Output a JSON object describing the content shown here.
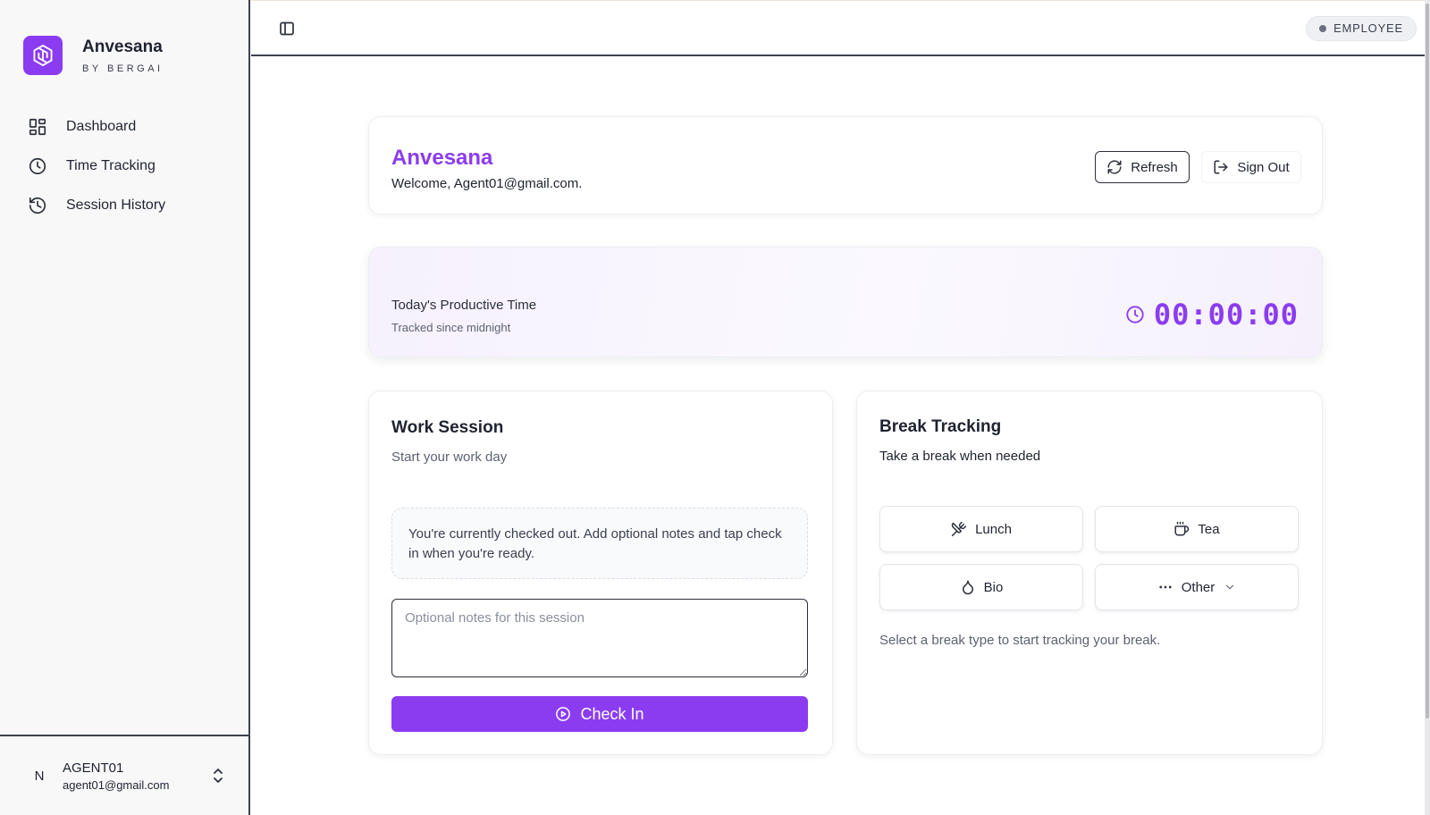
{
  "brand": {
    "name": "Anvesana",
    "subtitle": "BY BERGAI",
    "accent": "#8B3CF0"
  },
  "sidebar": {
    "items": [
      {
        "label": "Dashboard",
        "icon": "dashboard-icon"
      },
      {
        "label": "Time Tracking",
        "icon": "clock-icon"
      },
      {
        "label": "Session History",
        "icon": "history-icon"
      }
    ],
    "user": {
      "initial": "N",
      "name": "AGENT01",
      "email": "agent01@gmail.com"
    }
  },
  "header": {
    "role_badge": "EMPLOYEE",
    "toggle_icon": "sidebar-toggle-icon"
  },
  "welcome": {
    "title": "Anvesana",
    "text": "Welcome, Agent01@gmail.com.",
    "refresh_label": "Refresh",
    "signout_label": "Sign Out"
  },
  "productive": {
    "title": "Today's Productive Time",
    "subtitle": "Tracked since midnight",
    "timer": "00:00:00"
  },
  "work_session": {
    "title": "Work Session",
    "subtitle": "Start your work day",
    "notice": "You're currently checked out. Add optional notes and tap check in when you're ready.",
    "notes_placeholder": "Optional notes for this session",
    "notes_value": "",
    "checkin_label": "Check In"
  },
  "break_tracking": {
    "title": "Break Tracking",
    "subtitle": "Take a break when needed",
    "buttons": [
      {
        "label": "Lunch",
        "icon": "utensils-crossed-icon"
      },
      {
        "label": "Tea",
        "icon": "coffee-cup-icon"
      },
      {
        "label": "Bio",
        "icon": "droplet-icon"
      },
      {
        "label": "Other",
        "icon": "more-horizontal-icon"
      }
    ],
    "hint": "Select a break type to start tracking your break."
  }
}
